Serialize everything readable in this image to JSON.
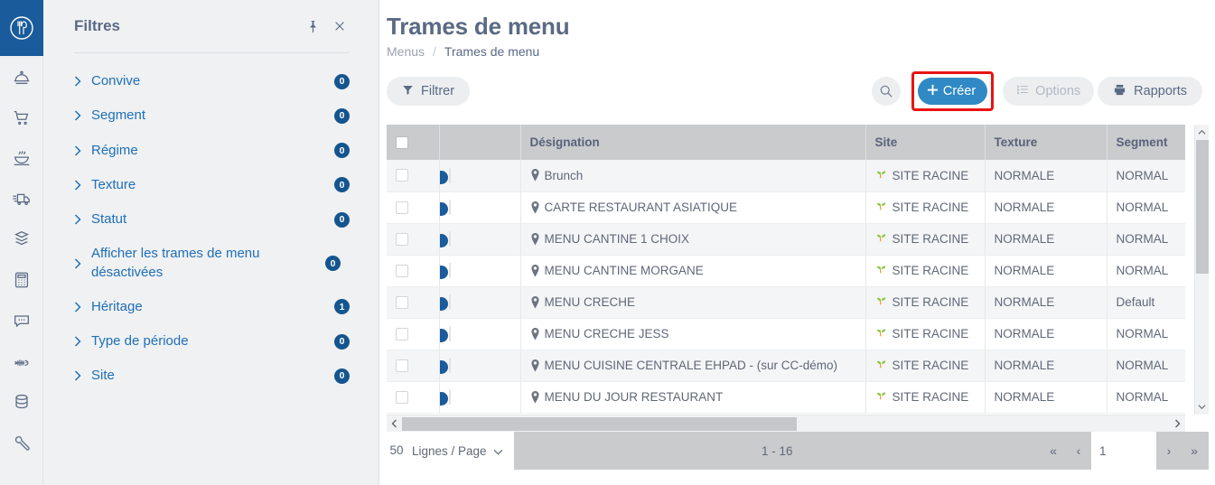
{
  "rail": {
    "logo_icon": "fork-spoon-logo",
    "items": [
      {
        "icon": "cloche-dome-icon",
        "name": "restauration"
      },
      {
        "icon": "shopping-cart-icon",
        "name": "achats"
      },
      {
        "icon": "soup-bowl-icon",
        "name": "production"
      },
      {
        "icon": "delivery-truck-icon",
        "name": "livraison"
      },
      {
        "icon": "stacked-box-icon",
        "name": "stocks"
      },
      {
        "icon": "calculator-icon",
        "name": "comptabilite"
      },
      {
        "icon": "chat-bubble-icon",
        "name": "messages"
      },
      {
        "icon": "fish-bone-icon",
        "name": "allergenes"
      },
      {
        "icon": "database-icon",
        "name": "donnees"
      },
      {
        "icon": "wrench-icon",
        "name": "parametres"
      }
    ]
  },
  "filters": {
    "title": "Filtres",
    "pin_icon": "pin-icon",
    "close_icon": "close-icon",
    "items": [
      {
        "label": "Convive",
        "count": "0",
        "wrap": false
      },
      {
        "label": "Segment",
        "count": "0",
        "wrap": false
      },
      {
        "label": "Régime",
        "count": "0",
        "wrap": false
      },
      {
        "label": "Texture",
        "count": "0",
        "wrap": false
      },
      {
        "label": "Statut",
        "count": "0",
        "wrap": false
      },
      {
        "label": "Afficher les trames de menu désactivées",
        "count": "0",
        "wrap": true
      },
      {
        "label": "Héritage",
        "count": "1",
        "wrap": false
      },
      {
        "label": "Type de période",
        "count": "0",
        "wrap": false
      },
      {
        "label": "Site",
        "count": "0",
        "wrap": false
      }
    ]
  },
  "header": {
    "title": "Trames de menu",
    "breadcrumb": {
      "parent": "Menus",
      "separator": "/",
      "current": "Trames de menu"
    }
  },
  "toolbar": {
    "filter_label": "Filtrer",
    "filter_icon": "funnel-icon",
    "search_icon": "search-icon",
    "create_label": "Créer",
    "create_icon": "plus-icon",
    "options_label": "Options",
    "options_icon": "list-options-icon",
    "reports_label": "Rapports",
    "reports_icon": "printer-icon",
    "highlight_color": "#e81313",
    "create_color": "#3089c4"
  },
  "table": {
    "columns": [
      "",
      "",
      "Désignation",
      "Site",
      "Texture",
      "Segment"
    ],
    "rows": [
      {
        "enabled": true,
        "designation": "Brunch",
        "site": "SITE RACINE",
        "texture": "NORMALE",
        "segment": "NORMAL"
      },
      {
        "enabled": true,
        "designation": "CARTE RESTAURANT ASIATIQUE",
        "site": "SITE RACINE",
        "texture": "NORMALE",
        "segment": "NORMAL"
      },
      {
        "enabled": true,
        "designation": "MENU CANTINE 1 CHOIX",
        "site": "SITE RACINE",
        "texture": "NORMALE",
        "segment": "NORMAL"
      },
      {
        "enabled": true,
        "designation": "MENU CANTINE MORGANE",
        "site": "SITE RACINE",
        "texture": "NORMALE",
        "segment": "NORMAL"
      },
      {
        "enabled": true,
        "designation": "MENU CRECHE",
        "site": "SITE RACINE",
        "texture": "NORMALE",
        "segment": "Default"
      },
      {
        "enabled": true,
        "designation": "MENU CRECHE JESS",
        "site": "SITE RACINE",
        "texture": "NORMALE",
        "segment": "NORMAL"
      },
      {
        "enabled": true,
        "designation": "MENU CUISINE CENTRALE EHPAD - (sur CC-démo)",
        "site": "SITE RACINE",
        "texture": "NORMALE",
        "segment": "NORMAL"
      },
      {
        "enabled": true,
        "designation": "MENU DU JOUR RESTAURANT",
        "site": "SITE RACINE",
        "texture": "NORMALE",
        "segment": "NORMAL"
      }
    ]
  },
  "pager": {
    "rows_per_page_value": "50",
    "rows_per_page_label": "Lignes / Page",
    "range": "1 - 16",
    "first_icon": "«",
    "prev_icon": "‹",
    "page_value": "1",
    "next_icon": "›",
    "last_icon": "»"
  }
}
